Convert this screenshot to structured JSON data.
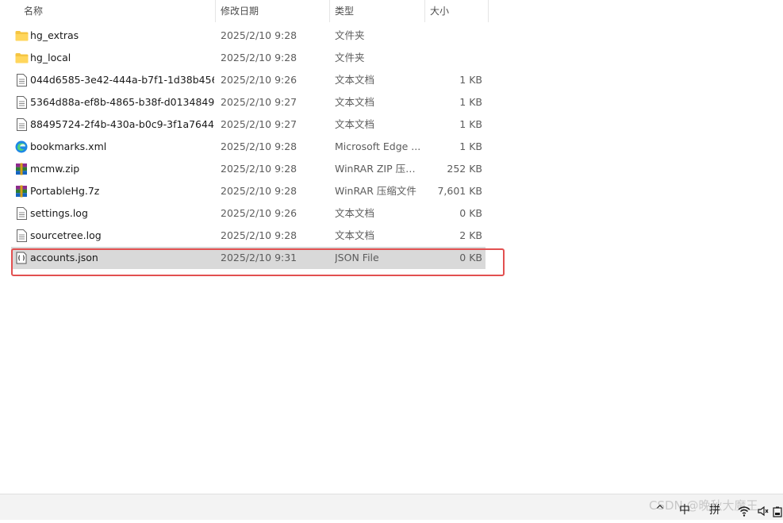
{
  "header": {
    "name": "名称",
    "date": "修改日期",
    "type": "类型",
    "size": "大小",
    "sort_caret": "^"
  },
  "files": [
    {
      "icon": "folder-icon",
      "name": "hg_extras",
      "date": "2025/2/10 9:28",
      "type": "文件夹",
      "size": ""
    },
    {
      "icon": "folder-icon",
      "name": "hg_local",
      "date": "2025/2/10 9:28",
      "type": "文件夹",
      "size": ""
    },
    {
      "icon": "text-file-icon",
      "name": "044d6585-3e42-444a-b7f1-1d38b456...",
      "date": "2025/2/10 9:26",
      "type": "文本文档",
      "size": "1 KB"
    },
    {
      "icon": "text-file-icon",
      "name": "5364d88a-ef8b-4865-b38f-d0134849...",
      "date": "2025/2/10 9:27",
      "type": "文本文档",
      "size": "1 KB"
    },
    {
      "icon": "text-file-icon",
      "name": "88495724-2f4b-430a-b0c9-3f1a7644...",
      "date": "2025/2/10 9:27",
      "type": "文本文档",
      "size": "1 KB"
    },
    {
      "icon": "edge-icon",
      "name": "bookmarks.xml",
      "date": "2025/2/10 9:28",
      "type": "Microsoft Edge ...",
      "size": "1 KB"
    },
    {
      "icon": "winrar-icon",
      "name": "mcmw.zip",
      "date": "2025/2/10 9:28",
      "type": "WinRAR ZIP 压缩...",
      "size": "252 KB"
    },
    {
      "icon": "winrar-icon",
      "name": "PortableHg.7z",
      "date": "2025/2/10 9:28",
      "type": "WinRAR 压缩文件",
      "size": "7,601 KB"
    },
    {
      "icon": "text-file-icon",
      "name": "settings.log",
      "date": "2025/2/10 9:26",
      "type": "文本文档",
      "size": "0 KB"
    },
    {
      "icon": "text-file-icon",
      "name": "sourcetree.log",
      "date": "2025/2/10 9:28",
      "type": "文本文档",
      "size": "2 KB"
    },
    {
      "icon": "json-file-icon",
      "name": "accounts.json",
      "date": "2025/2/10 9:31",
      "type": "JSON File",
      "size": "0 KB",
      "selected": true
    }
  ],
  "taskbar": {
    "watermark": "CSDN @晚秋大魔王",
    "ime_mode": "中",
    "ime_layout": "拼",
    "tray_chevron": "^"
  },
  "colors": {
    "selection": "#d9d9d9",
    "highlight_border": "#e25050",
    "folder": "#f5c542"
  }
}
